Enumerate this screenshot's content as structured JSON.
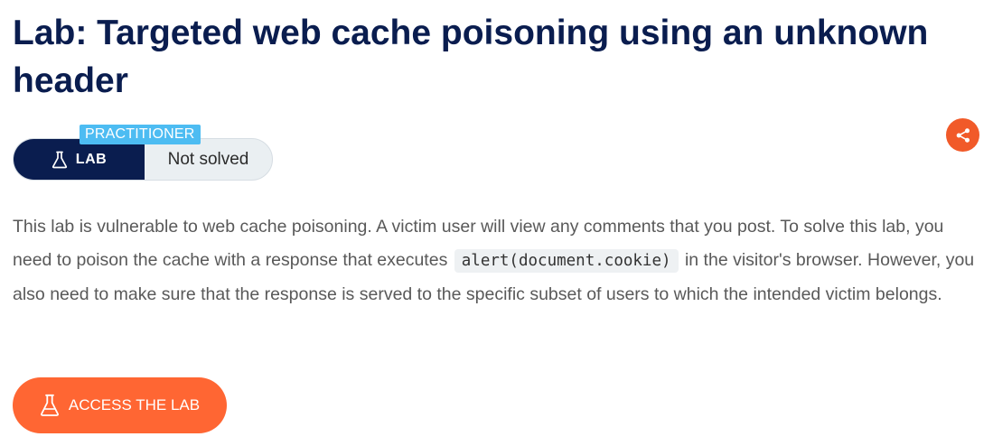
{
  "lab": {
    "title": "Lab: Targeted web cache poisoning using an unknown header",
    "level": "PRACTITIONER",
    "type_label": "LAB",
    "status": "Not solved",
    "description_part1": "This lab is vulnerable to web cache poisoning. A victim user will view any comments that you post. To solve this lab, you need to poison the cache with a response that executes ",
    "code": "alert(document.cookie)",
    "description_part2": " in the visitor's browser. However, you also need to make sure that the response is served to the specific subset of users to which the intended victim belongs.",
    "access_button": "ACCESS THE LAB"
  },
  "icons": {
    "lab_icon": "flask-icon",
    "share_icon": "share-icon",
    "access_icon": "flask-icon"
  },
  "colors": {
    "title": "#0a1d4f",
    "level_tag": "#4dbcf2",
    "lab_badge": "#0a1d4f",
    "accent": "#ff6633",
    "share": "#f15a29"
  }
}
